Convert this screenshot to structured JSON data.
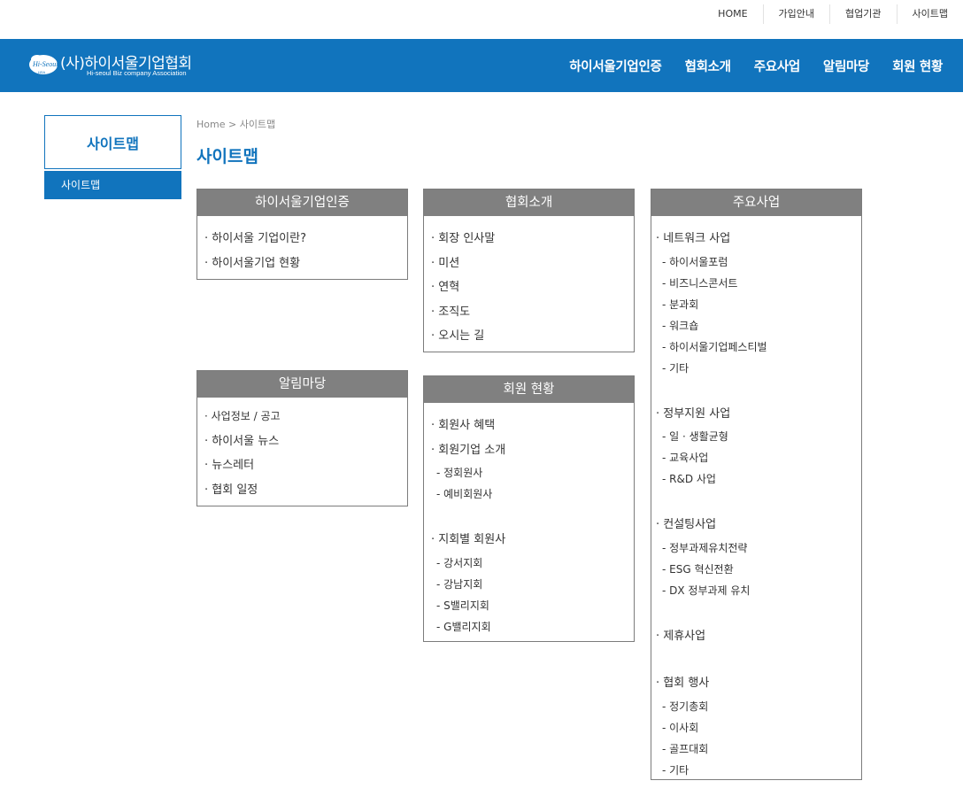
{
  "top_links": [
    "HOME",
    "가입안내",
    "협업기관",
    "사이트맵"
  ],
  "logo": {
    "mark_text": "Hi-Seoul",
    "mark_sub": "HSA",
    "name": "(사)하이서울기업협회",
    "eng": "Hi-seoul Biz company Association"
  },
  "gnb": [
    "하이서울기업인증",
    "협회소개",
    "주요사업",
    "알림마당",
    "회원 현황"
  ],
  "sidebar": {
    "title": "사이트맵",
    "items": [
      "사이트맵"
    ]
  },
  "breadcrumb": "Home > 사이트맵",
  "page_title": "사이트맵",
  "boxes": {
    "cert": {
      "title": "하이서울기업인증",
      "items": [
        "· 하이서울 기업이란?",
        "· 하이서울기업 현황"
      ]
    },
    "assoc": {
      "title": "협회소개",
      "items": [
        "· 회장 인사말",
        "· 미션",
        "· 연혁",
        "· 조직도",
        "· 오시는 길"
      ]
    },
    "business": {
      "title": "주요사업",
      "groups": [
        {
          "label": "· 네트워크 사업",
          "subs": [
            "- 하이서울포럼",
            "- 비즈니스콘서트",
            "- 분과회",
            "- 워크숍",
            "- 하이서울기업페스티벌",
            "- 기타"
          ]
        },
        {
          "label": "· 정부지원 사업",
          "subs": [
            "- 일 · 생활균형",
            "- 교육사업",
            "- R&D 사업"
          ]
        },
        {
          "label": "· 컨설팅사업",
          "subs": [
            "- 정부과제유치전략",
            "- ESG 혁신전환",
            "- DX 정부과제 유치"
          ]
        },
        {
          "label": "· 제휴사업",
          "subs": []
        },
        {
          "label": "· 협회 행사",
          "subs": [
            "- 정기총회",
            "- 이사회",
            "- 골프대회",
            "- 기타"
          ]
        }
      ]
    },
    "notice": {
      "title": "알림마당",
      "items": [
        "· 사업정보 / 공고",
        "· 하이서울 뉴스",
        "· 뉴스레터",
        "· 협회 일정"
      ]
    },
    "members": {
      "title": "회원 현황",
      "items": [
        "· 회원사 혜택",
        "· 회원기업 소개"
      ],
      "subs1": [
        "- 정회원사",
        "- 예비회원사"
      ],
      "region_label": "· 지회별 회원사",
      "subs2": [
        "- 강서지회",
        "- 강남지회",
        "- S밸리지회",
        "- G밸리지회"
      ]
    }
  },
  "colors": {
    "brand_blue": "#1174bd",
    "box_header_gray": "#808080"
  }
}
